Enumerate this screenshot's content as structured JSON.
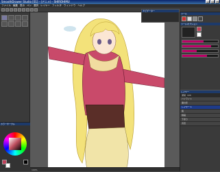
{
  "app": {
    "title": "SmoothDrawer Studio [01] - (アニメ) - SHIROHIMU",
    "window_buttons": [
      "_",
      "□",
      "×"
    ]
  },
  "menu": {
    "items": [
      "ファイル",
      "編集",
      "表示",
      "ペン",
      "選択",
      "レイヤー",
      "フィルタ",
      "ウィンドウ",
      "ヘルプ"
    ]
  },
  "navigator": {
    "title": "ナビゲーター"
  },
  "tool_panel": {
    "title": "ツール"
  },
  "tool_options": {
    "title": "ツールオプション"
  },
  "layers": {
    "title": "レイヤー",
    "blend_mode": "通常",
    "opacity": "100",
    "items": [
      {
        "label": "ハイライト"
      },
      {
        "label": "服の影"
      },
      {
        "label": "レイヤー 1"
      },
      {
        "label": "肌"
      },
      {
        "label": "線画"
      },
      {
        "label": "下塗り"
      },
      {
        "label": "背景"
      }
    ]
  },
  "color_panel": {
    "title": "カラーサークル"
  },
  "status": {
    "text": "100%"
  },
  "colors": {
    "accent": "#1e3b8a",
    "main_color": "#c0405a",
    "sub_color": "#ffffff",
    "hair": "#f3e27a",
    "jacket": "#c94a6a",
    "skin": "#fbe6d4"
  }
}
